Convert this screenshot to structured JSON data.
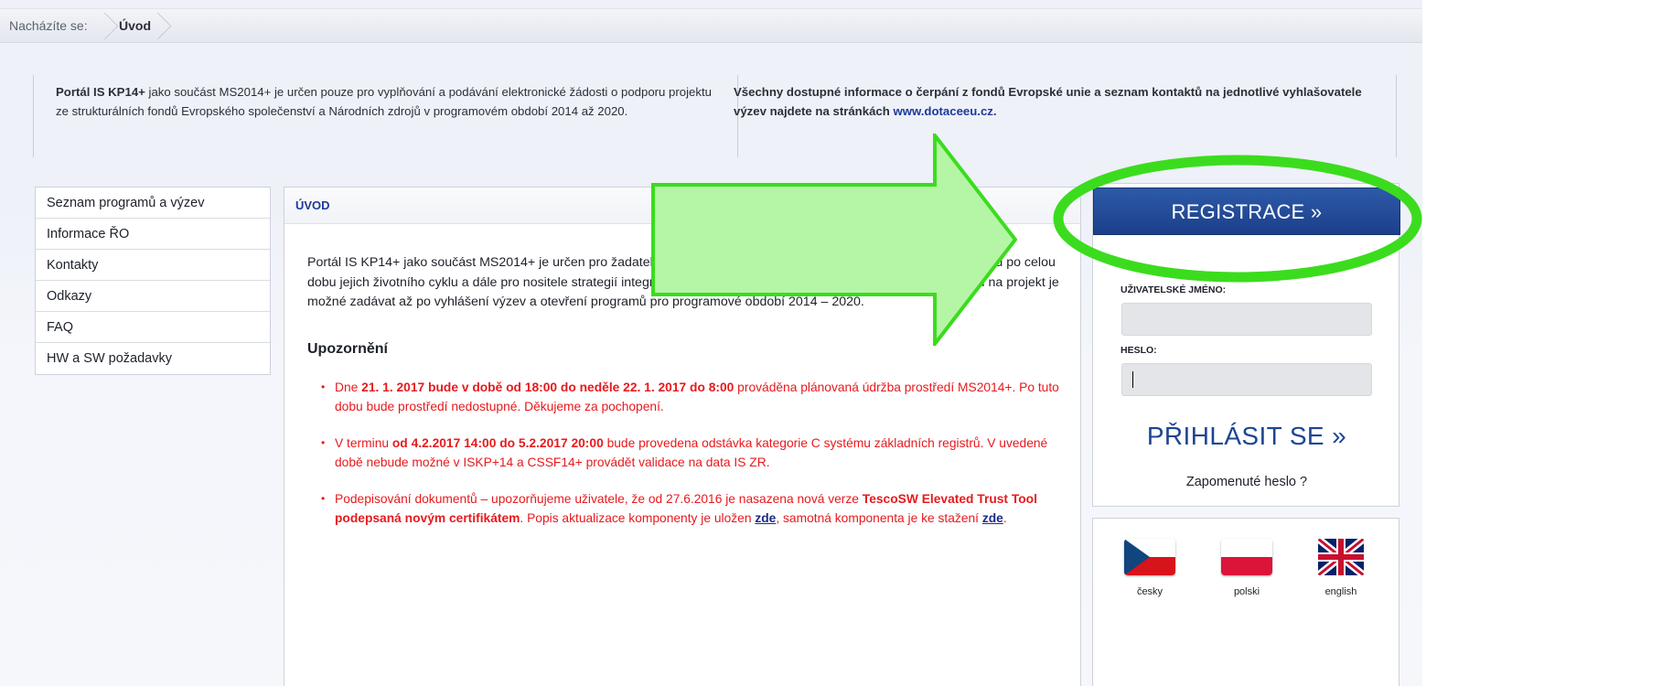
{
  "breadcrumb": {
    "label": "Nacházíte se:",
    "current": "Úvod"
  },
  "info": {
    "left_bold": "Portál IS KP14+",
    "left_text": " jako součást MS2014+ je určen pouze pro vyplňování a podávání elektronické žádosti o podporu projektu ze strukturálních fondů Evropského společenství a Národních zdrojů v programovém období 2014 až 2020.",
    "right_text": "Všechny dostupné informace o čerpání z fondů Evropské unie a seznam kontaktů na jednotlivé vyhlašovatele výzev najdete na stránkách ",
    "right_link": "www.dotaceeu.cz."
  },
  "menu": {
    "items": [
      {
        "label": "Seznam programů a výzev"
      },
      {
        "label": "Informace ŘO"
      },
      {
        "label": "Kontakty"
      },
      {
        "label": "Odkazy"
      },
      {
        "label": "FAQ"
      },
      {
        "label": "HW a SW požadavky"
      }
    ]
  },
  "main": {
    "title": "ÚVOD",
    "intro": "Portál IS KP14+ jako součást MS2014+ je určen pro žadatele/příjemce pro zadávání žádostí o podporu a správu projektů po celou dobu jejich životního cyklu a dále pro nositele strategií integrovaných nástrojů a externí hodnotitele. Žádosti o podporu na projekt je možné zadávat až po vyhlášení výzev a otevření programů pro programové období 2014 – 2020.",
    "warning_heading": "Upozornění",
    "warnings": [
      {
        "p1": "Dne ",
        "b1": "21. 1. 2017 bude v době od 18:00 do neděle 22. 1. 2017 do 8:00",
        "p2": " prováděna plánovaná údržba prostředí MS2014+. Po tuto dobu bude prostředí nedostupné. Děkujeme za pochopení."
      },
      {
        "p1": "V terminu ",
        "b1": "od 4.2.2017 14:00 do 5.2.2017 20:00",
        "p2": " bude provedena odstávka kategorie C systému základních registrů. V uvedené době nebude možné v ISKP+14 a CSSF14+ provádět validace na data IS ZR."
      },
      {
        "p1": "Podepisování dokumentů – upozorňujeme uživatele, že od 27.6.2016 je nasazena nová verze ",
        "b1": "TescoSW Elevated Trust Tool podepsaná novým certifikátem",
        "p2": ". Popis aktualizace komponenty je uložen ",
        "link1": "zde",
        "p3": ", samotná komponenta je ke stažení ",
        "link2": "zde",
        "p4": "."
      }
    ]
  },
  "login": {
    "register_label": "REGISTRACE »",
    "username_label": "UŽIVATELSKÉ JMÉNO:",
    "username_value": "",
    "password_label": "HESLO:",
    "password_value": "",
    "login_label": "PŘIHLÁSIT SE »",
    "forgot_label": "Zapomenuté heslo ?"
  },
  "languages": [
    {
      "label": "česky",
      "icon": "czech-flag-icon"
    },
    {
      "label": "polski",
      "icon": "polish-flag-icon"
    },
    {
      "label": "english",
      "icon": "uk-flag-icon"
    }
  ],
  "colors": {
    "accent_blue": "#1c4592",
    "warning_red": "#e8191d",
    "annotation_green": "#3bdc1e",
    "arrow_fill": "#b5f5a6"
  }
}
